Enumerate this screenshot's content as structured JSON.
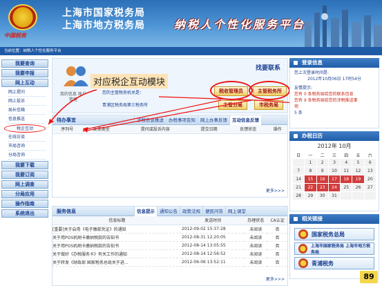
{
  "header": {
    "brand": "中国税务",
    "title_line1": "上海市国家税务局",
    "title_line2": "上海市地方税务局",
    "platform": "纳税人个性化服务平台"
  },
  "location": "当前位置：纳税人个性化服务平台",
  "leftnav": {
    "sections": [
      {
        "label": "我要查询"
      },
      {
        "label": "我要申报"
      },
      {
        "label": "网上互动"
      }
    ],
    "subitems": [
      "网上提问",
      "网上投诉",
      "局长信箱",
      "信息推送",
      "税企互动",
      "在线访谈",
      "市局咨询",
      "分局咨询"
    ],
    "sections2": [
      "我要下载",
      "我要订阅",
      "网上调查",
      "分局应用",
      "操作指南",
      "系统退出"
    ]
  },
  "user": {
    "label": "我的信息 账户管理",
    "welcome": "您的主管税务机关是：",
    "bureau": "青浦区税务局第三税务所",
    "annotation": "对应税企互动模块"
  },
  "quick": {
    "title": "找要联系",
    "btn1": "税收管理员",
    "btn2": "主管税务所",
    "btn3": "主管分局",
    "btn4": "市税务局"
  },
  "todo": {
    "title": "待办事宜",
    "tabs": [
      "涉税信息推送",
      "办税事项告知",
      "网上办事反馈",
      "互动信息反馈"
    ],
    "columns": [
      "序列号",
      "反馈类型",
      "提问或投诉内容",
      "提交日期",
      "反馈状态",
      "操作"
    ],
    "more": "更多>>>"
  },
  "service": {
    "title": "服务信息",
    "tabs": [
      "信息提示",
      "通知公告",
      "政策法规",
      "便民问答",
      "网上课堂"
    ],
    "columns": [
      "信息标题",
      "发送时间",
      "办理状态",
      "CA认证"
    ],
    "rows": [
      {
        "title": "[重要]关于启用《电子缴款凭证》的通知",
        "time": "2012-09-02 15:37:28",
        "status": "未阅读",
        "ca": "否"
      },
      {
        "title": "关于用POS机刷卡缴纳税款的告知书",
        "time": "2012-08-31 12:20:05",
        "status": "未阅读",
        "ca": "否"
      },
      {
        "title": "关于用POS机刷卡缴纳税款的告知书",
        "time": "2012-08-14 13:05:55",
        "status": "未阅读",
        "ca": "否"
      },
      {
        "title": "关于做好《办税服务卡》有关工作的通知",
        "time": "2012-08-14 12:56:52",
        "status": "未阅读",
        "ca": "否"
      },
      {
        "title": "关于转发《财政部 国家税务总局关于进...",
        "time": "2012-06-06 13:52:11",
        "status": "未阅读",
        "ca": "否"
      }
    ],
    "more": "更多>>>"
  },
  "login_info": {
    "title": "登录信息",
    "line1": "您上次登录时间是:",
    "line2": "2012年10月06日 17时54分",
    "notice_label": "友情提示:",
    "notice1": "您有 0 条税务局给您的联系信息",
    "notice2": "您有 9 条税务局给您的涉税推送事",
    "notice3": "项",
    "count": "5 条"
  },
  "calendar": {
    "title": "办税日历",
    "year": "2012",
    "year_unit": "年",
    "month": "10",
    "month_unit": "月",
    "weekdays": [
      "日",
      "一",
      "二",
      "三",
      "四",
      "五",
      "六"
    ],
    "days": [
      "",
      "1",
      "2",
      "3",
      "4",
      "5",
      "6",
      "7",
      "8",
      "9",
      "10",
      "11",
      "12",
      "13",
      "14",
      "15",
      "16",
      "17",
      "18",
      "19",
      "20",
      "21",
      "22",
      "23",
      "24",
      "25",
      "26",
      "27",
      "28",
      "29",
      "30",
      "31",
      "",
      "",
      ""
    ],
    "highlight": [
      "15",
      "16",
      "17",
      "18",
      "19",
      "22",
      "23",
      "24"
    ]
  },
  "links": {
    "title": "相关链接",
    "items": [
      "国家税务总局",
      "上海市国家税务局 上海市地方税务局",
      "青浦税务"
    ]
  },
  "page_number": "89"
}
